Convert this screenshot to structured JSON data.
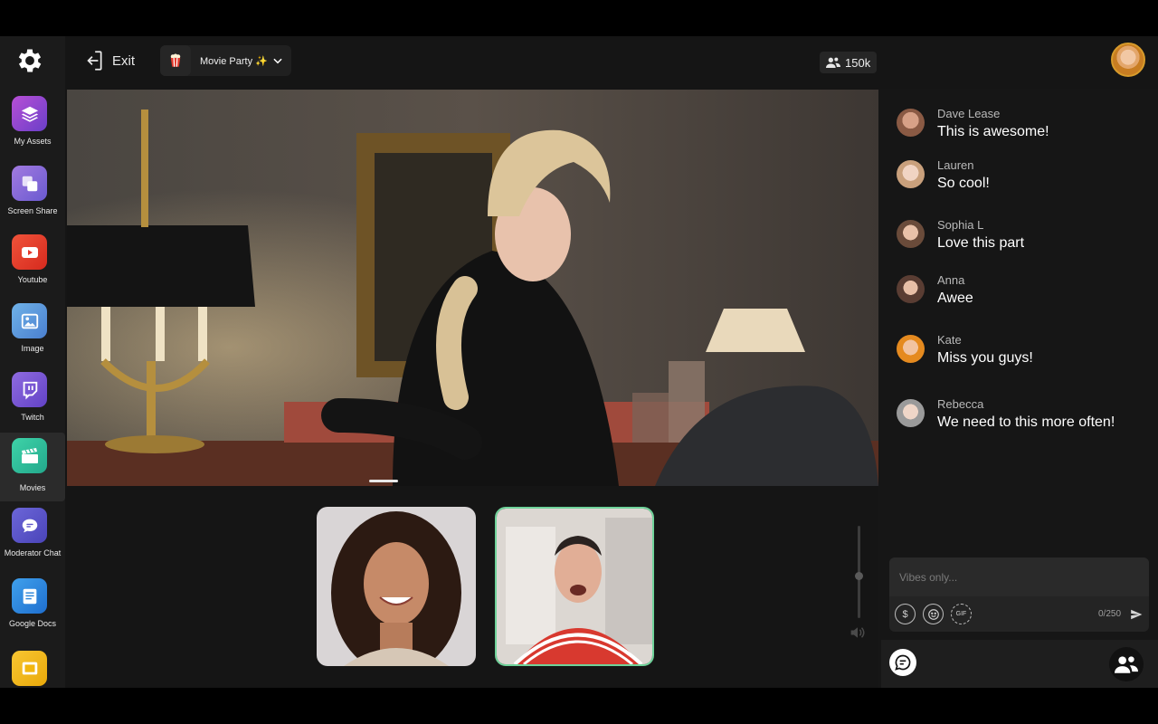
{
  "sidebar": {
    "items": [
      {
        "label": "My Assets",
        "icon": "layers-icon",
        "color": "#8e44c9"
      },
      {
        "label": "Screen Share",
        "icon": "screen-share-icon",
        "color": "#8c6fd6"
      },
      {
        "label": "Youtube",
        "icon": "youtube-icon",
        "color": "#e53a2b"
      },
      {
        "label": "Image",
        "icon": "image-icon",
        "color": "#5b9bd9"
      },
      {
        "label": "Twitch",
        "icon": "twitch-icon",
        "color": "#7a5bd8"
      },
      {
        "label": "Movies",
        "icon": "clapperboard-icon",
        "color": "#2fbf9a"
      },
      {
        "label": "Moderator Chat",
        "icon": "chat-bubble-icon",
        "color": "#5d55c9"
      },
      {
        "label": "Google Docs",
        "icon": "document-icon",
        "color": "#2e86d9"
      },
      {
        "label": "",
        "icon": "slides-icon",
        "color": "#f2b60f"
      }
    ]
  },
  "topbar": {
    "exit_label": "Exit",
    "room_title": "Movie Party ✨",
    "viewer_count": "150k"
  },
  "chat": {
    "messages": [
      {
        "name": "Dave Lease",
        "text": "This is awesome!",
        "avatar_color": "#8a5a44"
      },
      {
        "name": "Lauren",
        "text": "So cool!",
        "avatar_color": "#c9a07c"
      },
      {
        "name": "Sophia L",
        "text": "Love this part",
        "avatar_color": "#6a4b3a"
      },
      {
        "name": "Anna",
        "text": "Awee",
        "avatar_color": "#5a3d33"
      },
      {
        "name": "Kate",
        "text": "Miss you guys!",
        "avatar_color": "#e58a1f"
      },
      {
        "name": "Rebecca",
        "text": "We need to this more often!",
        "avatar_color": "#9a9a9a"
      }
    ],
    "input_placeholder": "Vibes only...",
    "char_counter": "0/250"
  },
  "colors": {
    "accent_green": "#6fd39a",
    "background": "#151515"
  }
}
